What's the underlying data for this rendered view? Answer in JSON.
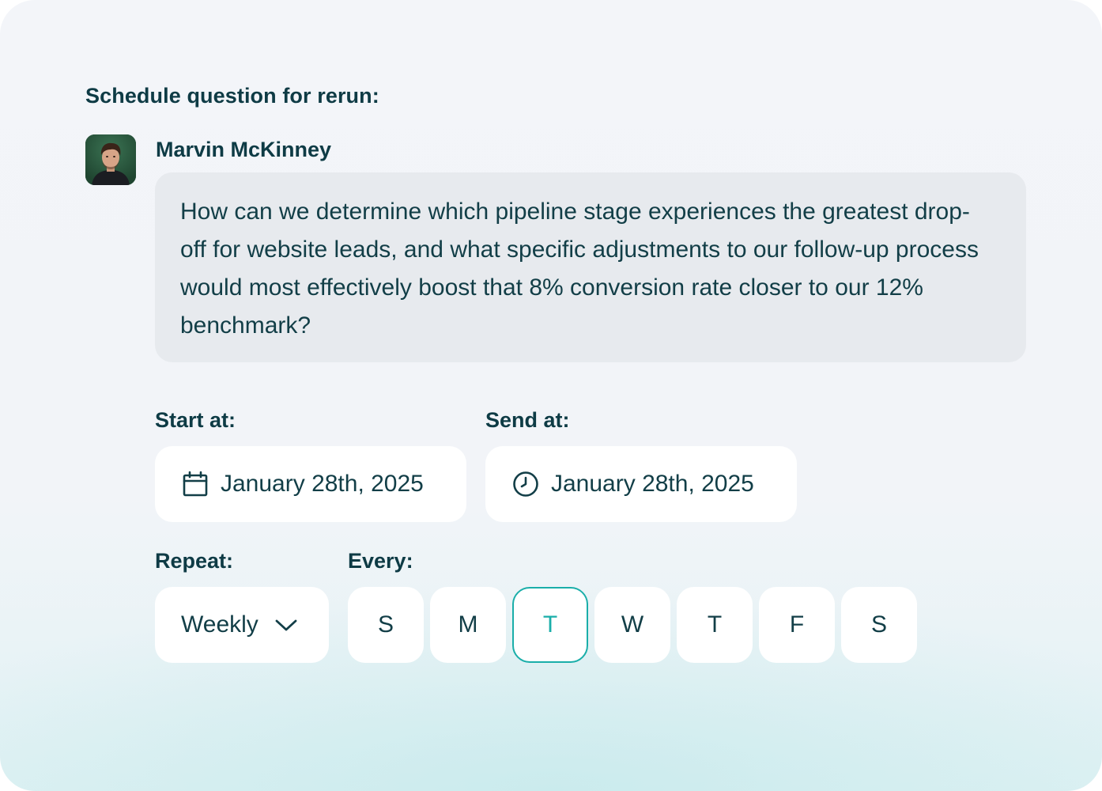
{
  "heading": "Schedule question for rerun:",
  "author": {
    "name": "Marvin McKinney"
  },
  "question": {
    "text": "How can we determine which pipeline stage experiences the greatest drop-off for website leads, and what specific adjustments to our follow-up process would most effectively boost that 8% conversion rate closer to our 12% benchmark?"
  },
  "start": {
    "label": "Start at:",
    "value": "January 28th, 2025",
    "icon": "calendar-icon"
  },
  "send": {
    "label": "Send at:",
    "value": "January 28th, 2025",
    "icon": "clock-icon"
  },
  "repeat": {
    "label": "Repeat:",
    "value": "Weekly",
    "icon": "chevron-down-icon"
  },
  "every": {
    "label": "Every:",
    "days": [
      "S",
      "M",
      "T",
      "W",
      "T",
      "F",
      "S"
    ],
    "selected_index": 2
  },
  "colors": {
    "text": "#0e3b45",
    "accent": "#1aaea9",
    "bubble": "#e7eaee"
  }
}
